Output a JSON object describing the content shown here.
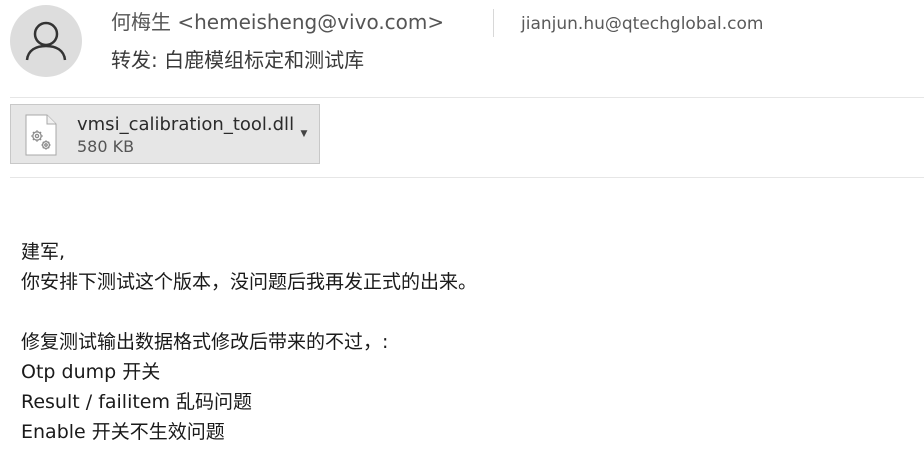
{
  "header": {
    "avatar_icon": "person-icon",
    "sender": "何梅生 <hemeisheng@vivo.com>",
    "recipient": "jianjun.hu@qtechglobal.com",
    "subject": "转发: 白鹿模组标定和测试库"
  },
  "attachment": {
    "icon": "dll-file-gear-icon",
    "name": "vmsi_calibration_tool.dll",
    "size": "580 KB",
    "caret_icon": "chevron-down-icon"
  },
  "body": {
    "lines": [
      "建军,",
      "你安排下测试这个版本，没问题后我再发正式的出来。",
      "",
      "修复测试输出数据格式修改后带来的不过，:",
      "Otp dump 开关",
      "Result / failitem 乱码问题",
      "Enable 开关不生效问题"
    ]
  },
  "colors": {
    "avatar_bg": "#dddddd",
    "attachment_bg": "#e6e6e6",
    "attachment_border": "#c8c8c8",
    "divider": "#e6e6e6"
  }
}
